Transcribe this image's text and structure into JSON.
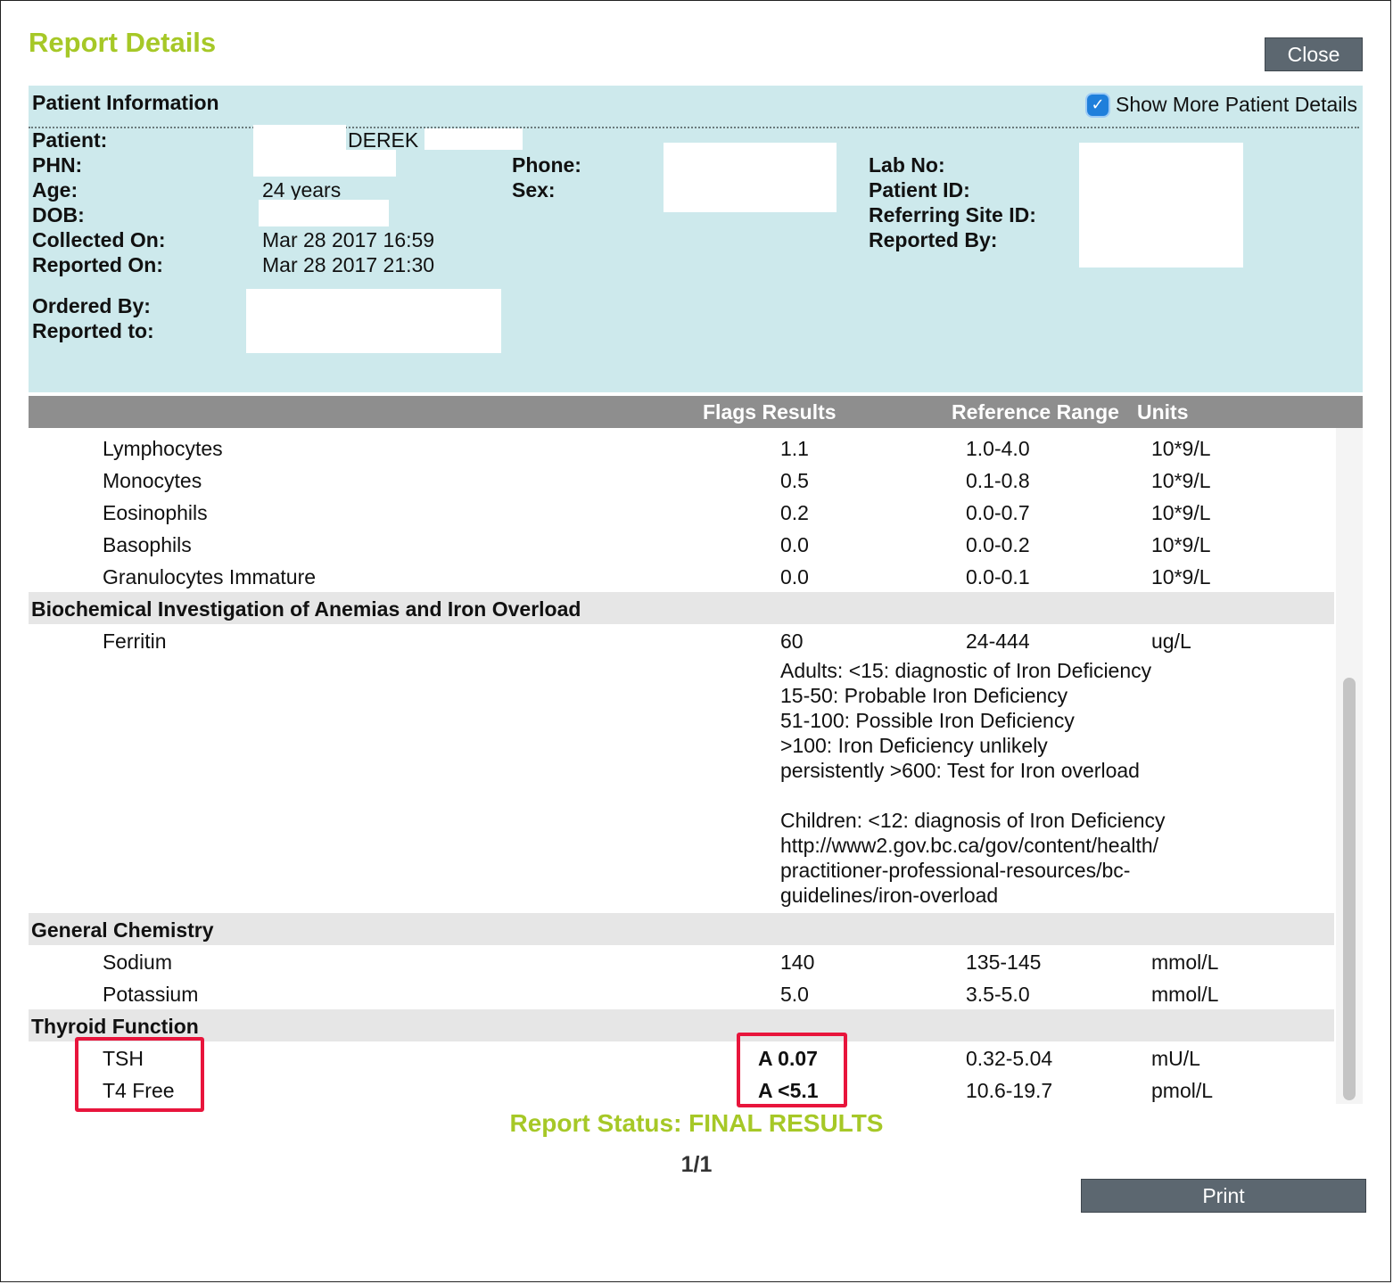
{
  "header": {
    "title": "Report Details",
    "close_label": "Close"
  },
  "patient_info": {
    "title": "Patient Information",
    "show_more_label": "Show More Patient Details",
    "show_more_checked": true,
    "labels": {
      "patient": "Patient:",
      "phn": "PHN:",
      "age": "Age:",
      "dob": "DOB:",
      "collected_on": "Collected On:",
      "reported_on": "Reported On:",
      "phone": "Phone:",
      "sex": "Sex:",
      "lab_no": "Lab No:",
      "patient_id": "Patient ID:",
      "referring_site_id": "Referring Site ID:",
      "reported_by": "Reported By:",
      "ordered_by": "Ordered By:",
      "reported_to": "Reported to:"
    },
    "values": {
      "patient_name": "DEREK",
      "age": "24 years",
      "collected_on": "Mar 28 2017 16:59",
      "reported_on": "Mar 28 2017 21:30"
    }
  },
  "table": {
    "headers": {
      "flags_results": "Flags Results",
      "reference_range": "Reference Range",
      "units": "Units"
    },
    "rows_top": [
      {
        "name": "Lymphocytes",
        "result": "1.1",
        "range": "1.0-4.0",
        "unit": "10*9/L"
      },
      {
        "name": "Monocytes",
        "result": "0.5",
        "range": "0.1-0.8",
        "unit": "10*9/L"
      },
      {
        "name": "Eosinophils",
        "result": "0.2",
        "range": "0.0-0.7",
        "unit": "10*9/L"
      },
      {
        "name": "Basophils",
        "result": "0.0",
        "range": "0.0-0.2",
        "unit": "10*9/L"
      },
      {
        "name": "Granulocytes Immature",
        "result": "0.0",
        "range": "0.0-0.1",
        "unit": "10*9/L"
      }
    ],
    "section_iron": "Biochemical Investigation of Anemias and Iron Overload",
    "ferritin": {
      "name": "Ferritin",
      "result": "60",
      "range": "24-444",
      "unit": "ug/L"
    },
    "ferritin_note": [
      "Adults: <15: diagnostic of Iron Deficiency",
      "15-50: Probable Iron Deficiency",
      "51-100: Possible Iron Deficiency",
      ">100: Iron Deficiency unlikely",
      "persistently >600: Test for Iron overload",
      "",
      "Children: <12: diagnosis of Iron Deficiency",
      "http://www2.gov.bc.ca/gov/content/health/",
      "practitioner-professional-resources/bc-",
      "guidelines/iron-overload"
    ],
    "section_chem": "General Chemistry",
    "sodium": {
      "name": "Sodium",
      "result": "140",
      "range": "135-145",
      "unit": "mmol/L"
    },
    "potassium": {
      "name": "Potassium",
      "result": "5.0",
      "range": "3.5-5.0",
      "unit": "mmol/L"
    },
    "section_thyroid": "Thyroid Function",
    "tsh": {
      "name": "TSH",
      "result": "A 0.07",
      "range": "0.32-5.04",
      "unit": "mU/L"
    },
    "t4": {
      "name": "T4 Free",
      "result": "A <5.1",
      "range": "10.6-19.7",
      "unit": "pmol/L"
    }
  },
  "footer": {
    "status": "Report Status: FINAL RESULTS",
    "page": "1/1",
    "print_label": "Print"
  },
  "colors": {
    "accent": "#a6c827",
    "panel": "#cde9ec",
    "header_bar": "#8e8e8e",
    "highlight": "#e8153c",
    "button": "#5c6770"
  }
}
